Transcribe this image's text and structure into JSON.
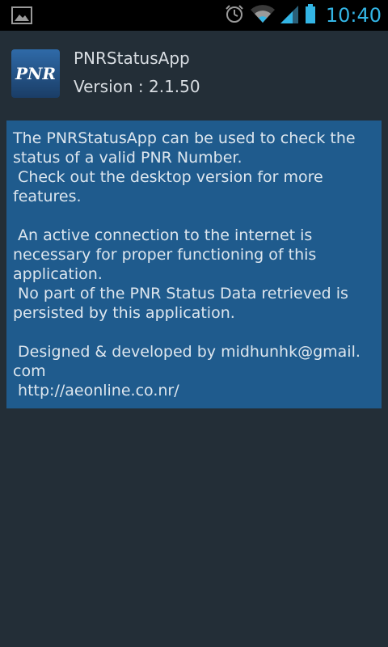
{
  "statusbar": {
    "left_icon": "gallery-image-icon",
    "icons": [
      "alarm-clock-icon",
      "wifi-icon",
      "cell-signal-icon",
      "battery-icon"
    ],
    "time": "10:40",
    "accent_color": "#33b5e5"
  },
  "app": {
    "icon_label": "PNR",
    "name": "PNRStatusApp",
    "version": "Version : 2.1.50"
  },
  "about": {
    "background_color": "#1f5b8d",
    "text_main": "The PNRStatusApp can be used to check the status of a valid PNR Number.\n Check out the desktop version for more features.\n\n An active connection to the internet is necessary for proper functioning of this application.\n No part of the PNR Status Data retrieved is persisted by this application.\n\n Designed & developed by midhunhk@gmail.\ncom\n ",
    "link": "http://aeonline.co.nr/"
  }
}
